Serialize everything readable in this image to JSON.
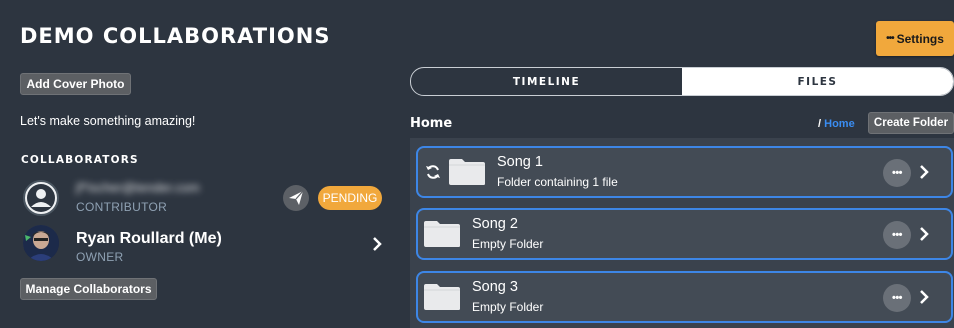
{
  "project": {
    "title": "DEMO COLLABORATIONS"
  },
  "header": {
    "settings_label": "Settings",
    "settings_icon": "more-dots-icon"
  },
  "left_panel": {
    "cover_button": "Add Cover Photo",
    "tagline": "Let's make something amazing!",
    "collaborators_heading": "COLLABORATORS",
    "collaborators": [
      {
        "email": "jf*ischer@tender.com",
        "role": "CONTRIBUTOR",
        "status": "PENDING",
        "avatar": "default-user-icon"
      },
      {
        "name": "Ryan Roullard (Me)",
        "role": "OWNER",
        "avatar": "profile-photo"
      }
    ],
    "manage_button": "Manage Collaborators"
  },
  "tabs": [
    {
      "label": "TIMELINE",
      "active": false
    },
    {
      "label": "FILES",
      "active": true
    }
  ],
  "files": {
    "current_folder": "Home",
    "breadcrumb_separator": "/",
    "breadcrumb": "Home",
    "create_folder_button": "Create Folder",
    "folders": [
      {
        "name": "Song 1",
        "description": "Folder containing 1 file",
        "syncing": true
      },
      {
        "name": "Song 2",
        "description": "Empty Folder",
        "syncing": false
      },
      {
        "name": "Song 3",
        "description": "Empty Folder",
        "syncing": false
      }
    ]
  },
  "colors": {
    "background": "#2d3540",
    "accent_orange": "#f1a83c",
    "selection_blue": "#3d86e6",
    "link_blue": "#3a8df2"
  }
}
